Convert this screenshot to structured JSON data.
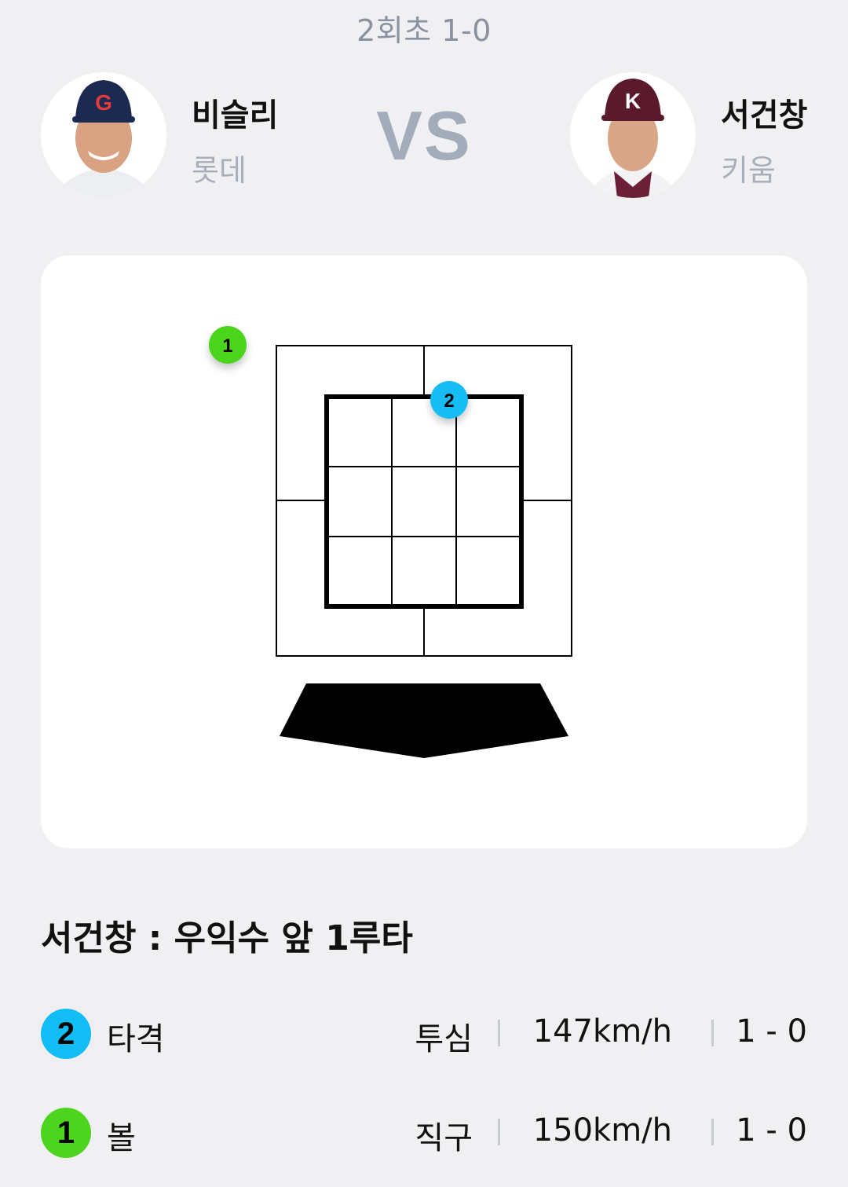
{
  "inning": "2회초 1-0",
  "vs_label": "VS",
  "batter": {
    "name": "비슬리",
    "team": "롯데",
    "cap_letter": "G"
  },
  "pitcher": {
    "name": "서건창",
    "team": "키움",
    "cap_letter": "K"
  },
  "pitch_markers": [
    {
      "number": "1",
      "color": "#4cd41f"
    },
    {
      "number": "2",
      "color": "#12bdf5"
    }
  ],
  "result_text": "서건창 : 우익수 앞 1루타",
  "pitches": [
    {
      "number": "2",
      "result": "타격",
      "pitch_type": "투심",
      "speed": "147km/h",
      "count": "1 - 0",
      "color": "#12bdf5"
    },
    {
      "number": "1",
      "result": "볼",
      "pitch_type": "직구",
      "speed": "150km/h",
      "count": "1 - 0",
      "color": "#4cd41f"
    }
  ],
  "separator": "|"
}
